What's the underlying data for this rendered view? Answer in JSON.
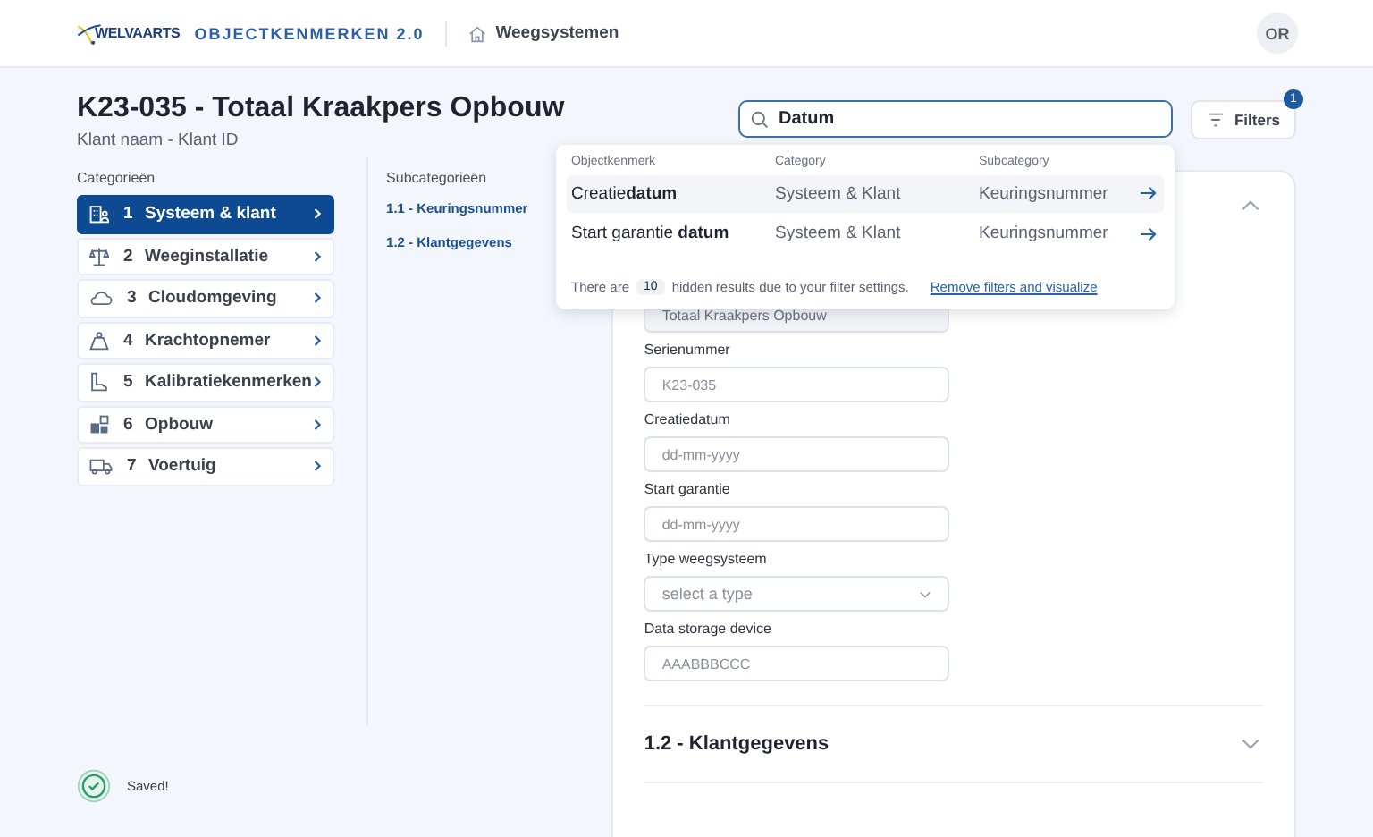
{
  "header": {
    "logo_text": "WELVAARTS",
    "app_name": "OBJECTKENMERKEN 2.0",
    "breadcrumb": "Weegsystemen",
    "avatar": "OR"
  },
  "page": {
    "title": "K23-035 - Totaal Kraakpers Opbouw",
    "subtitle": "Klant naam - Klant ID"
  },
  "search": {
    "value": "Datum"
  },
  "filters": {
    "label": "Filters",
    "badge": "1"
  },
  "results": {
    "columns": [
      "Objectkenmerk",
      "Category",
      "Subcategory"
    ],
    "rows": [
      {
        "name": "Creatie**datum**",
        "category": "Systeem & Klant",
        "subcategory": "Keuringsnummer",
        "selected": true
      },
      {
        "name": "Start garantie **datum**",
        "category": "Systeem & Klant",
        "subcategory": "Keuringsnummer",
        "selected": false
      }
    ],
    "footer_before": "There are",
    "hidden_count": "10",
    "footer_after": "hidden results due to your filter settings.",
    "link": "Remove filters and visualize"
  },
  "categories": {
    "heading": "Categorieën",
    "items": [
      {
        "number": "1",
        "label": "Systeem & klant",
        "selected": true
      },
      {
        "number": "2",
        "label": "Weeginstallatie",
        "selected": false
      },
      {
        "number": "3",
        "label": "Cloudomgeving",
        "selected": false
      },
      {
        "number": "4",
        "label": "Krachtopnemer",
        "selected": false
      },
      {
        "number": "5",
        "label": "Kalibratiekenmerken",
        "selected": false
      },
      {
        "number": "6",
        "label": "Opbouw",
        "selected": false
      },
      {
        "number": "7",
        "label": "Voertuig",
        "selected": false
      }
    ]
  },
  "subcategories": {
    "heading": "Subcategorieën",
    "items": [
      "1.1 - Keuringsnummer",
      "1.2 - Klantgegevens"
    ]
  },
  "sections": [
    {
      "expanded": true,
      "fields": [
        {
          "kind": "text",
          "value": "Totaal Kraakpers Opbouw",
          "disabled": true
        },
        {
          "kind": "text",
          "label": "Serienummer",
          "placeholder": "K23-035",
          "disabled": false
        },
        {
          "kind": "text",
          "label": "Creatiedatum",
          "placeholder": "dd-mm-yyyy",
          "disabled": false
        },
        {
          "kind": "text",
          "label": "Start garantie",
          "placeholder": "dd-mm-yyyy",
          "disabled": false
        },
        {
          "kind": "select",
          "label": "Type weegsysteem",
          "placeholder": "select a type",
          "disabled": false
        },
        {
          "kind": "text",
          "label": "Data storage device",
          "placeholder": "AAABBBCCC",
          "disabled": false
        }
      ]
    },
    {
      "title": "1.2 - Klantgegevens",
      "expanded": false
    }
  ],
  "toast": {
    "text": "Saved!"
  }
}
